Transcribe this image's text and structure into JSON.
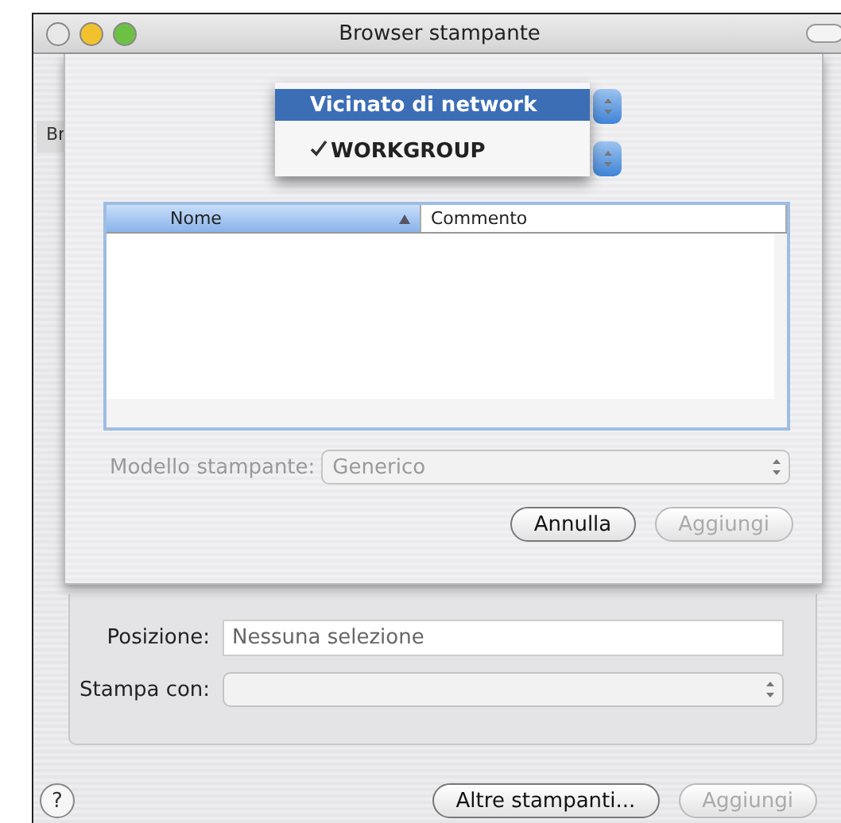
{
  "window": {
    "title": "Browser stampante"
  },
  "background": {
    "tab_label": "Br",
    "location": {
      "label": "Posizione:",
      "value": "Nessuna selezione"
    },
    "print_with": {
      "label": "Stampa con:",
      "disabled": true
    },
    "buttons": [
      {
        "kind": "help",
        "label": "?",
        "disabled": false
      },
      {
        "kind": "push",
        "label": "Altre stampanti...",
        "disabled": false
      },
      {
        "kind": "push",
        "label": "Aggiungi",
        "disabled": true
      }
    ]
  },
  "sheet": {
    "menu": [
      {
        "label": "Vicinato di network",
        "highlighted": true,
        "checked": false
      },
      {
        "label": "WORKGROUP",
        "highlighted": false,
        "checked": true
      }
    ],
    "table": {
      "columns": [
        {
          "label": "Nome",
          "sorted": true
        },
        {
          "label": "Commento",
          "sorted": false
        }
      ]
    },
    "model": {
      "label": "Modello stampante:",
      "value": "Generico",
      "disabled": true
    },
    "buttons": [
      {
        "label": "Annulla",
        "disabled": false
      },
      {
        "label": "Aggiungi",
        "disabled": true
      }
    ]
  }
}
